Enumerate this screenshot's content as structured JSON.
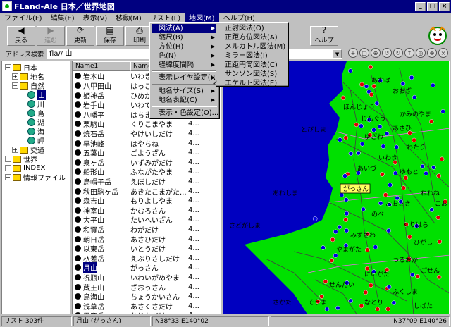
{
  "window": {
    "title": "FLand-Ale 日本／世界地図"
  },
  "menubar": [
    {
      "label": "ファイル(F)"
    },
    {
      "label": "編集(E)"
    },
    {
      "label": "表示(V)"
    },
    {
      "label": "移動(M)"
    },
    {
      "label": "リスト(L)"
    },
    {
      "label": "地図(M)"
    },
    {
      "label": "ヘルプ(H)"
    }
  ],
  "toolbar": [
    {
      "label": "戻る",
      "icon": "◀"
    },
    {
      "label": "進む",
      "icon": "▶"
    },
    {
      "label": "更新",
      "icon": "⟳"
    },
    {
      "label": "保存",
      "icon": "▤"
    },
    {
      "label": "印刷",
      "icon": "⎙"
    },
    {
      "label": "ヘルプ",
      "icon": "?"
    }
  ],
  "address": {
    "label": "アドレス検索",
    "value": "fla// 山"
  },
  "tree": [
    {
      "label": "日本",
      "box": "−"
    },
    {
      "label": "地名",
      "box": "+"
    },
    {
      "label": "自然",
      "box": "−"
    },
    {
      "label": "山"
    },
    {
      "label": "川"
    },
    {
      "label": "島"
    },
    {
      "label": "湖"
    },
    {
      "label": "海"
    },
    {
      "label": "岬"
    },
    {
      "label": "交通",
      "box": "+"
    },
    {
      "label": "世界",
      "box": "+"
    },
    {
      "label": "INDEX",
      "box": "+"
    },
    {
      "label": "情報ファイル",
      "box": "+"
    }
  ],
  "list": {
    "headers": [
      "Name1",
      "Name",
      ""
    ],
    "rows": [
      {
        "name": "岩木山",
        "reading": "いわき",
        "v": ""
      },
      {
        "name": "八甲田山",
        "reading": "はっこ",
        "v": ""
      },
      {
        "name": "姫神岳",
        "reading": "ひめか",
        "v": ""
      },
      {
        "name": "岩手山",
        "reading": "いわて",
        "v": ""
      },
      {
        "name": "八幡平",
        "reading": "はちま",
        "v": ""
      },
      {
        "name": "栗駒山",
        "reading": "くりこまやま",
        "v": "4..."
      },
      {
        "name": "焼石岳",
        "reading": "やけいしだけ",
        "v": "4..."
      },
      {
        "name": "早池峰",
        "reading": "はやちね",
        "v": "4..."
      },
      {
        "name": "五葉山",
        "reading": "ごようざん",
        "v": "4..."
      },
      {
        "name": "泉ヶ岳",
        "reading": "いずみがだけ",
        "v": "4..."
      },
      {
        "name": "船形山",
        "reading": "ふながたやま",
        "v": "4..."
      },
      {
        "name": "烏帽子岳",
        "reading": "えぼしだけ",
        "v": "4..."
      },
      {
        "name": "秋田駒ヶ岳",
        "reading": "あきたこまがた...",
        "v": "4..."
      },
      {
        "name": "森吉山",
        "reading": "もりよしやま",
        "v": "4..."
      },
      {
        "name": "神室山",
        "reading": "かむろさん",
        "v": "4..."
      },
      {
        "name": "大平山",
        "reading": "たいへいざん",
        "v": "4..."
      },
      {
        "name": "和賀岳",
        "reading": "わがだけ",
        "v": "4..."
      },
      {
        "name": "朝日岳",
        "reading": "あさひだけ",
        "v": "4..."
      },
      {
        "name": "以東岳",
        "reading": "いとうだけ",
        "v": "4..."
      },
      {
        "name": "杁差岳",
        "reading": "えぶりさしだけ",
        "v": "4..."
      },
      {
        "name": "月山",
        "reading": "がっさん",
        "v": "4..."
      },
      {
        "name": "祝瓶山",
        "reading": "いわいがめやま",
        "v": "4..."
      },
      {
        "name": "蔵王山",
        "reading": "ざおうさん",
        "v": "4..."
      },
      {
        "name": "鳥海山",
        "reading": "ちょうかいさん",
        "v": "4..."
      },
      {
        "name": "浅草岳",
        "reading": "あさくさだけ",
        "v": "4..."
      },
      {
        "name": "男鹿岳",
        "reading": "おじかだけ",
        "v": "4..."
      }
    ]
  },
  "map": {
    "labels": [
      {
        "text": "とびしま"
      },
      {
        "text": "あわしま"
      },
      {
        "text": "さどがしま"
      },
      {
        "text": "がっさん"
      },
      {
        "text": "あおば"
      },
      {
        "text": "おおぎ"
      },
      {
        "text": "ほんじょう"
      },
      {
        "text": "かみのやま"
      },
      {
        "text": "じんぐう"
      },
      {
        "text": "あさひ"
      },
      {
        "text": "ゆざわ"
      },
      {
        "text": "わたり"
      },
      {
        "text": "いわき"
      },
      {
        "text": "あいづ"
      },
      {
        "text": "ゆもと"
      },
      {
        "text": "ねわね"
      },
      {
        "text": "おおさき"
      },
      {
        "text": "こおり"
      },
      {
        "text": "のべ"
      },
      {
        "text": "くりはら"
      },
      {
        "text": "みずさわ"
      },
      {
        "text": "ひがし"
      },
      {
        "text": "やまがた"
      },
      {
        "text": "つるおか"
      },
      {
        "text": "にいがた"
      },
      {
        "text": "ごせん"
      },
      {
        "text": "せんだい"
      },
      {
        "text": "ふくしま"
      },
      {
        "text": "なとり"
      },
      {
        "text": "そうま"
      },
      {
        "text": "しばた"
      },
      {
        "text": "さかた"
      }
    ]
  },
  "menu_map": [
    {
      "label": "図法(A)"
    },
    {
      "label": "縮尺(B)"
    },
    {
      "label": "方位(H)"
    },
    {
      "label": "色(N)"
    },
    {
      "label": "経緯度間隔"
    },
    {
      "label": "表示レイヤ設定(R)"
    },
    {
      "label": "地名サイズ(S)"
    },
    {
      "label": "地名表記(C)"
    },
    {
      "label": "表示・色設定(O)..."
    }
  ],
  "menu_projection": [
    {
      "label": "正射図法(O)"
    },
    {
      "label": "正距方位図法(A)"
    },
    {
      "label": "メルカトル図法(M)"
    },
    {
      "label": "ミラー図法(I)"
    },
    {
      "label": "正距円筒図法(C)"
    },
    {
      "label": "サンソン図法(S)"
    },
    {
      "label": "エケルト図法(E)"
    }
  ],
  "status": {
    "count": "リスト 303件",
    "selected": "月山 (がっさん)",
    "coord1": "N38°33 E140°02",
    "coord2": "N37°09 E140°26"
  }
}
